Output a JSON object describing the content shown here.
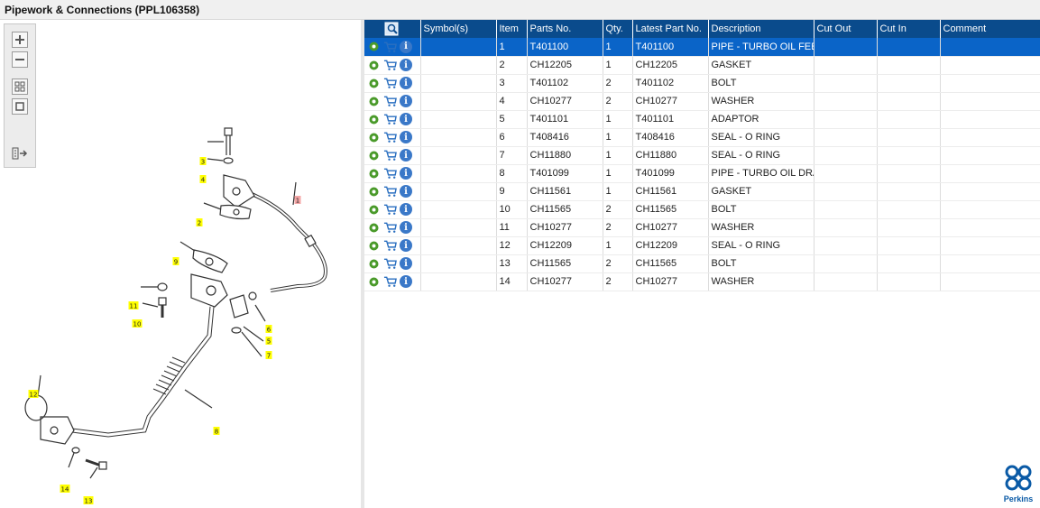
{
  "window": {
    "title": "Pipework & Connections (PPL106358)"
  },
  "toolbar": {
    "buttons": [
      {
        "name": "zoom-in-button",
        "icon": "plus-icon"
      },
      {
        "name": "zoom-out-button",
        "icon": "minus-icon"
      },
      {
        "name": "fit-all-button",
        "icon": "grid-icon"
      },
      {
        "name": "actual-size-button",
        "icon": "square-icon"
      },
      {
        "name": "export-button",
        "icon": "list-arrow-icon"
      }
    ]
  },
  "diagram": {
    "labels": [
      "1",
      "2",
      "3",
      "4",
      "5",
      "6",
      "7",
      "8",
      "9",
      "10",
      "11",
      "12",
      "13",
      "14"
    ],
    "highlight_color": "#ffff00",
    "selected_color": "#f4a6a6"
  },
  "table": {
    "headers": [
      "",
      "Symbol(s)",
      "Item",
      "Parts No.",
      "Qty.",
      "Latest Part No.",
      "Description",
      "Cut Out",
      "Cut In",
      "Comment"
    ],
    "rows": [
      {
        "symbols": "",
        "item": "1",
        "part": "T401100",
        "qty": "1",
        "latest": "T401100",
        "desc": "PIPE - TURBO OIL FEED",
        "cut_out": "",
        "cut_in": "",
        "comment": ""
      },
      {
        "symbols": "",
        "item": "2",
        "part": "CH12205",
        "qty": "1",
        "latest": "CH12205",
        "desc": "GASKET",
        "cut_out": "",
        "cut_in": "",
        "comment": ""
      },
      {
        "symbols": "",
        "item": "3",
        "part": "T401102",
        "qty": "2",
        "latest": "T401102",
        "desc": "BOLT",
        "cut_out": "",
        "cut_in": "",
        "comment": ""
      },
      {
        "symbols": "",
        "item": "4",
        "part": "CH10277",
        "qty": "2",
        "latest": "CH10277",
        "desc": "WASHER",
        "cut_out": "",
        "cut_in": "",
        "comment": ""
      },
      {
        "symbols": "",
        "item": "5",
        "part": "T401101",
        "qty": "1",
        "latest": "T401101",
        "desc": "ADAPTOR",
        "cut_out": "",
        "cut_in": "",
        "comment": ""
      },
      {
        "symbols": "",
        "item": "6",
        "part": "T408416",
        "qty": "1",
        "latest": "T408416",
        "desc": "SEAL - O RING",
        "cut_out": "",
        "cut_in": "",
        "comment": ""
      },
      {
        "symbols": "",
        "item": "7",
        "part": "CH11880",
        "qty": "1",
        "latest": "CH11880",
        "desc": "SEAL - O RING",
        "cut_out": "",
        "cut_in": "",
        "comment": ""
      },
      {
        "symbols": "",
        "item": "8",
        "part": "T401099",
        "qty": "1",
        "latest": "T401099",
        "desc": "PIPE - TURBO OIL DRA",
        "cut_out": "",
        "cut_in": "",
        "comment": ""
      },
      {
        "symbols": "",
        "item": "9",
        "part": "CH11561",
        "qty": "1",
        "latest": "CH11561",
        "desc": "GASKET",
        "cut_out": "",
        "cut_in": "",
        "comment": ""
      },
      {
        "symbols": "",
        "item": "10",
        "part": "CH11565",
        "qty": "2",
        "latest": "CH11565",
        "desc": "BOLT",
        "cut_out": "",
        "cut_in": "",
        "comment": ""
      },
      {
        "symbols": "",
        "item": "11",
        "part": "CH10277",
        "qty": "2",
        "latest": "CH10277",
        "desc": "WASHER",
        "cut_out": "",
        "cut_in": "",
        "comment": ""
      },
      {
        "symbols": "",
        "item": "12",
        "part": "CH12209",
        "qty": "1",
        "latest": "CH12209",
        "desc": "SEAL - O RING",
        "cut_out": "",
        "cut_in": "",
        "comment": ""
      },
      {
        "symbols": "",
        "item": "13",
        "part": "CH11565",
        "qty": "2",
        "latest": "CH11565",
        "desc": "BOLT",
        "cut_out": "",
        "cut_in": "",
        "comment": ""
      },
      {
        "symbols": "",
        "item": "14",
        "part": "CH10277",
        "qty": "2",
        "latest": "CH10277",
        "desc": "WASHER",
        "cut_out": "",
        "cut_in": "",
        "comment": ""
      }
    ],
    "selected_index": 0
  },
  "logo": {
    "text": "Perkins",
    "color": "#0a5aa6"
  }
}
